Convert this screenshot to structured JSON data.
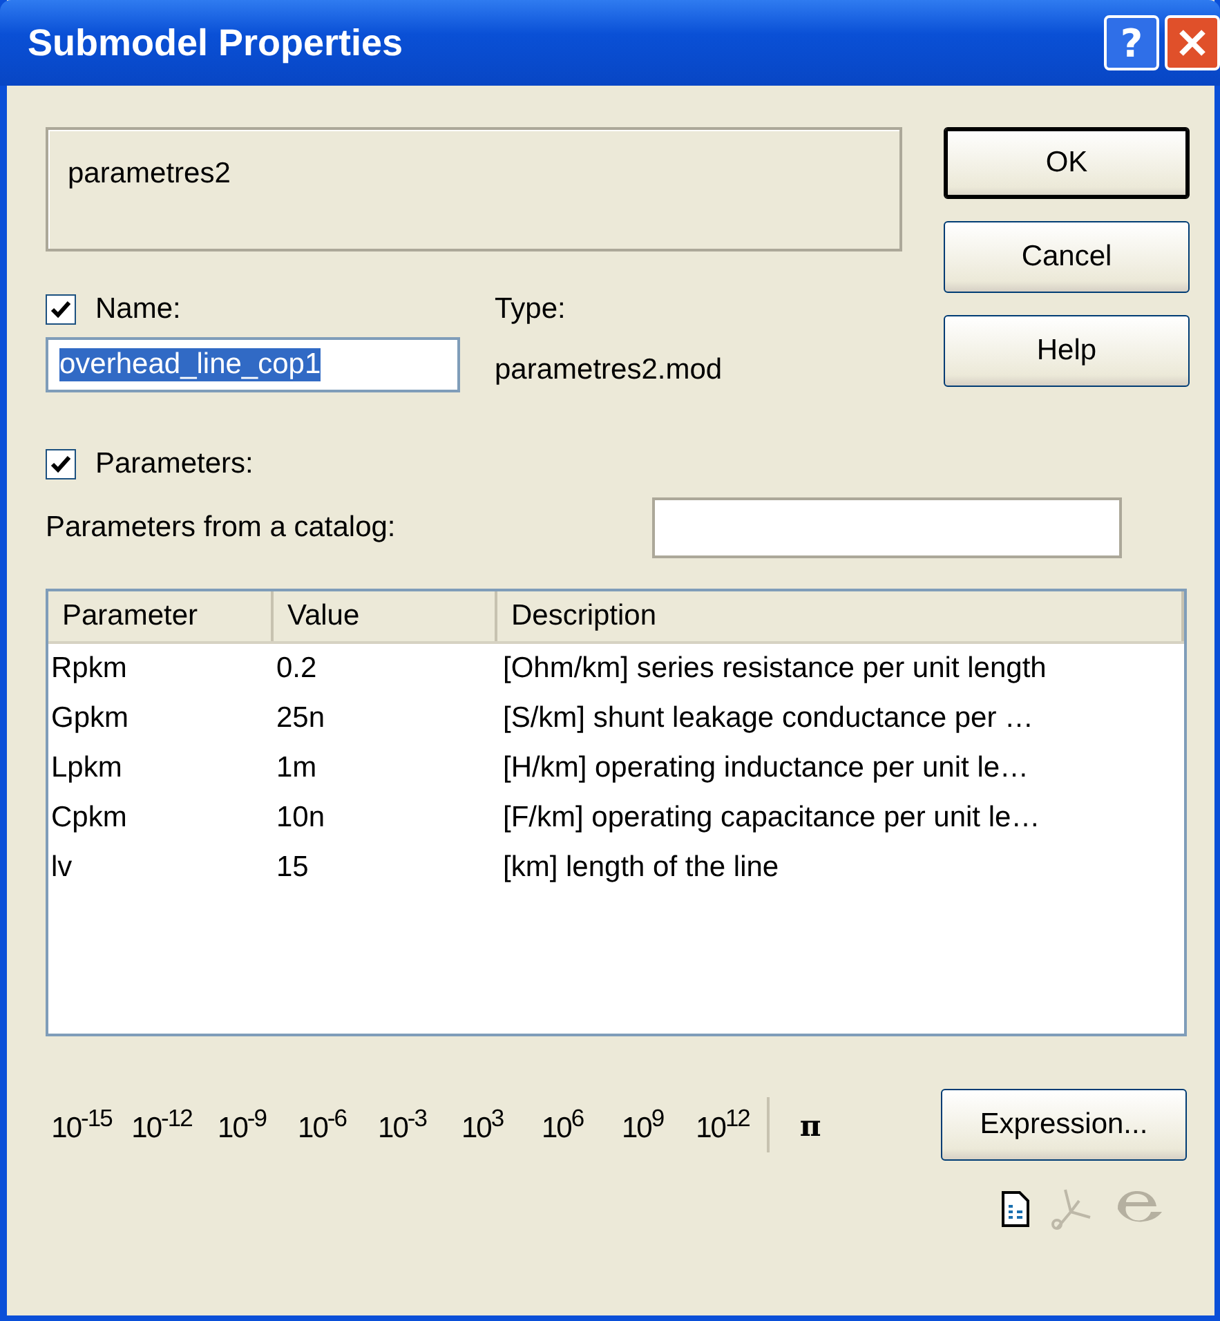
{
  "window": {
    "title": "Submodel Properties",
    "help_button": "?"
  },
  "description": "parametres2",
  "buttons": [
    {
      "label": "OK",
      "default": true
    },
    {
      "label": "Cancel",
      "default": false
    },
    {
      "label": "Help",
      "default": false
    }
  ],
  "name": {
    "checked": true,
    "label": "Name:",
    "value": "overhead_line_cop1"
  },
  "type": {
    "label": "Type:",
    "value": "parametres2.mod"
  },
  "parameters": {
    "checked": true,
    "label": "Parameters:"
  },
  "catalog": {
    "label": "Parameters from a catalog:"
  },
  "table": {
    "columns": [
      "Parameter",
      "Value",
      "Description"
    ],
    "rows": [
      [
        "Rpkm",
        "0.2",
        "[Ohm/km] series resistance per unit length"
      ],
      [
        "Gpkm",
        "25n",
        "[S/km] shunt leakage conductance per …"
      ],
      [
        "Lpkm",
        "1m",
        "[H/km] operating inductance per unit le…"
      ],
      [
        "Cpkm",
        "10n",
        "[F/km] operating capacitance per unit le…"
      ],
      [
        "lv",
        "15",
        "[km] length of the line"
      ]
    ]
  },
  "powers": [
    "10$^{-15}$",
    "10$^{-12}$",
    "10$^{-9}$",
    "10$^{-6}$",
    "10$^{-3}$",
    "10$^{3}$",
    "10$^{6}$",
    "10$^{9}$",
    "10$^{12}$"
  ],
  "pi": "π",
  "expression_button": "Expression..."
}
